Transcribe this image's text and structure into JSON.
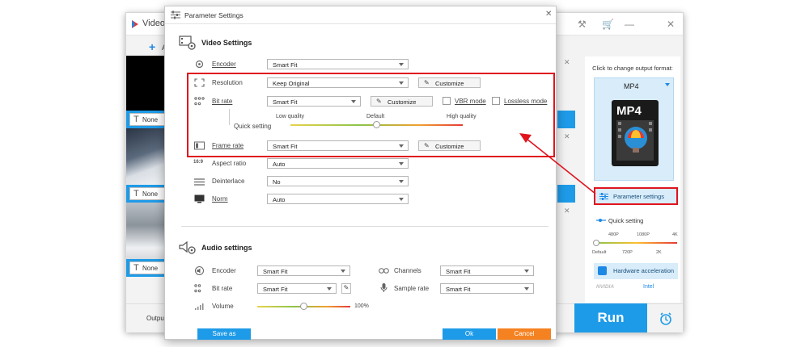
{
  "app": {
    "title": "Video",
    "add_label": "A",
    "none_labels": [
      "None",
      "None",
      "None"
    ],
    "output_label": "Outpu",
    "run_label": "Run"
  },
  "right_panel": {
    "click_to_change": "Click to change output format:",
    "format": "MP4",
    "format_badge": "MP4",
    "parameter_settings": "Parameter settings",
    "quick_setting": "Quick setting",
    "quality_top": [
      "480P",
      "1080P",
      "4K"
    ],
    "quality_bottom": [
      "Default",
      "720P",
      "2K"
    ],
    "hardware_acceleration": "Hardware acceleration",
    "brands": [
      "NVIDIA",
      "Intel"
    ]
  },
  "dialog": {
    "title": "Parameter Settings",
    "video_section": "Video Settings",
    "audio_section": "Audio settings",
    "video": {
      "encoder": {
        "label": "Encoder",
        "value": "Smart Fit"
      },
      "resolution": {
        "label": "Resolution",
        "value": "Keep Original",
        "customize": "Customize"
      },
      "bitrate": {
        "label": "Bit rate",
        "value": "Smart Fit",
        "customize": "Customize",
        "vbr": "VBR mode",
        "lossless": "Lossless mode"
      },
      "quick_setting": {
        "label": "Quick setting",
        "low": "Low quality",
        "default": "Default",
        "high": "High quality"
      },
      "framerate": {
        "label": "Frame rate",
        "value": "Smart Fit",
        "customize": "Customize"
      },
      "aspect": {
        "label": "Aspect ratio",
        "value": "Auto"
      },
      "deinterlace": {
        "label": "Deinterlace",
        "value": "No"
      },
      "norm": {
        "label": "Norm",
        "value": "Auto"
      }
    },
    "audio": {
      "encoder": {
        "label": "Encoder",
        "value": "Smart Fit"
      },
      "bitrate": {
        "label": "Bit rate",
        "value": "Smart Fit"
      },
      "volume": {
        "label": "Volume",
        "value": "100%",
        "level": 0.5
      },
      "channels": {
        "label": "Channels",
        "value": "Smart Fit"
      },
      "sample_rate": {
        "label": "Sample rate",
        "value": "Smart Fit"
      }
    },
    "buttons": {
      "save_as": "Save as",
      "ok": "Ok",
      "cancel": "Cancel"
    }
  },
  "colors": {
    "accent": "#1e9be8",
    "highlight": "#e0141e",
    "cancel": "#f58220"
  }
}
